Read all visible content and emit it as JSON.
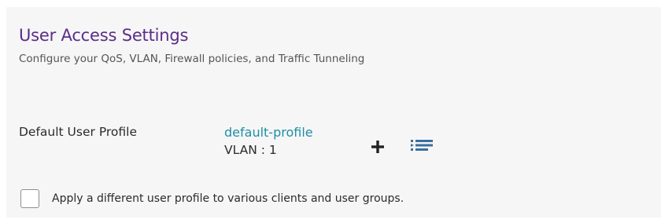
{
  "section": {
    "title": "User Access Settings",
    "subtitle": "Configure your QoS, VLAN, Firewall policies, and Traffic Tunneling"
  },
  "profile_row": {
    "label": "Default User Profile",
    "profile_name": "default-profile",
    "vlan": "VLAN : 1",
    "add_icon": "plus-icon",
    "list_icon": "list-icon"
  },
  "apply_option": {
    "label": "Apply a different user profile to various clients and user groups.",
    "checked": false
  },
  "colors": {
    "title": "#5b2d86",
    "link": "#1f8fa3",
    "panel_bg": "#f6f6f7"
  }
}
